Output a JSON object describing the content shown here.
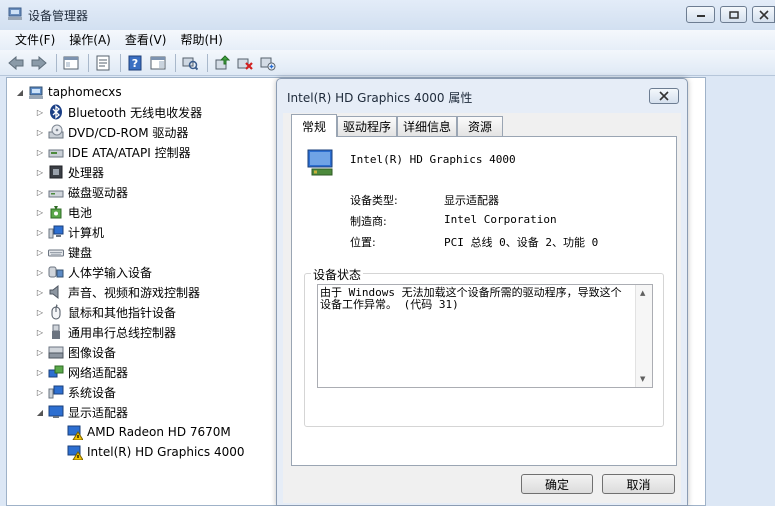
{
  "window": {
    "title": "设备管理器"
  },
  "menu": [
    "文件(F)",
    "操作(A)",
    "查看(V)",
    "帮助(H)"
  ],
  "tree": {
    "root": "taphomecxs",
    "categories": [
      {
        "label": "Bluetooth 无线电收发器",
        "icon": "bluetooth-icon"
      },
      {
        "label": "DVD/CD-ROM 驱动器",
        "icon": "dvd-drive-icon"
      },
      {
        "label": "IDE ATA/ATAPI 控制器",
        "icon": "ide-controller-icon"
      },
      {
        "label": "处理器",
        "icon": "processor-icon"
      },
      {
        "label": "磁盘驱动器",
        "icon": "disk-drive-icon"
      },
      {
        "label": "电池",
        "icon": "battery-icon"
      },
      {
        "label": "计算机",
        "icon": "computer-icon"
      },
      {
        "label": "键盘",
        "icon": "keyboard-icon"
      },
      {
        "label": "人体学输入设备",
        "icon": "hid-icon"
      },
      {
        "label": "声音、视频和游戏控制器",
        "icon": "sound-icon"
      },
      {
        "label": "鼠标和其他指针设备",
        "icon": "mouse-icon"
      },
      {
        "label": "通用串行总线控制器",
        "icon": "usb-icon"
      },
      {
        "label": "图像设备",
        "icon": "imaging-device-icon"
      },
      {
        "label": "网络适配器",
        "icon": "network-adapter-icon"
      },
      {
        "label": "系统设备",
        "icon": "system-device-icon"
      },
      {
        "label": "显示适配器",
        "icon": "display-adapter-icon"
      }
    ],
    "display_children": [
      "AMD Radeon HD 7670M",
      "Intel(R) HD Graphics 4000"
    ]
  },
  "dialog": {
    "title": "Intel(R) HD Graphics 4000 属性",
    "tabs": [
      "常规",
      "驱动程序",
      "详细信息",
      "资源"
    ],
    "device_name": "Intel(R) HD Graphics 4000",
    "properties": [
      {
        "label": "设备类型:",
        "value": "显示适配器"
      },
      {
        "label": "制造商:",
        "value": "Intel Corporation"
      },
      {
        "label": "位置:",
        "value": "PCI 总线 0、设备 2、功能 0"
      }
    ],
    "status_label": "设备状态",
    "status_text": "由于 Windows 无法加载这个设备所需的驱动程序，导致这个设备工作异常。 (代码 31)",
    "ok_label": "确定",
    "cancel_label": "取消"
  }
}
